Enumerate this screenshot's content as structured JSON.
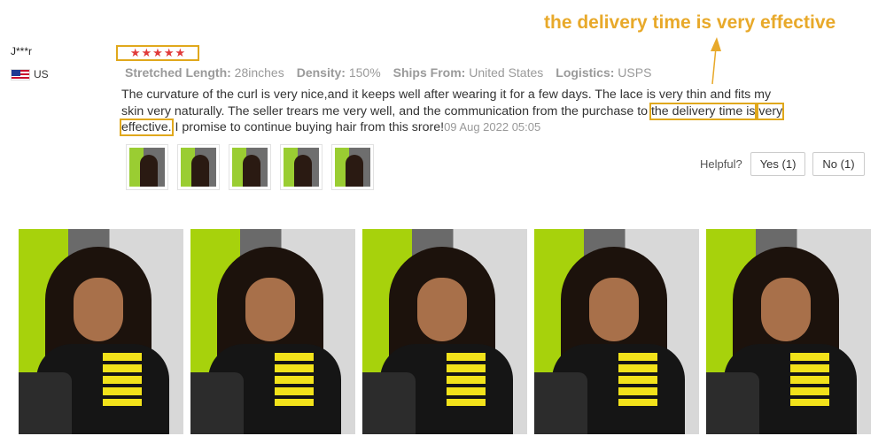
{
  "reviewer": {
    "name": "J***r",
    "country": "US"
  },
  "rating": {
    "stars": 5,
    "max": 5,
    "star_color": "#e03a3a"
  },
  "meta": [
    {
      "key": "Stretched Length:",
      "value": "28inches"
    },
    {
      "key": "Density:",
      "value": "150%"
    },
    {
      "key": "Ships From:",
      "value": "United States"
    },
    {
      "key": "Logistics:",
      "value": "USPS"
    }
  ],
  "review": {
    "text_before": "The curvature of the curl is very nice,and it keeps well after wearing it for a few days. The lace is very thin and fits my skin very naturally. The seller trears me very well, and the communication from the purchase to ",
    "highlight_1": "the delivery time is",
    "highlight_2": "very effective.",
    "text_after": " I promise to continue buying hair from this srore!",
    "date": "09 Aug 2022 05:05"
  },
  "thumbnails_count": 5,
  "helpful": {
    "label": "Helpful?",
    "yes": "Yes (1)",
    "no": "No (1)"
  },
  "annotation": {
    "text": "the delivery time is very effective",
    "color": "#e8a92a"
  },
  "photos_count": 5,
  "colors": {
    "highlight_border": "#e0a81c",
    "meta_text": "#9a9a9a"
  }
}
